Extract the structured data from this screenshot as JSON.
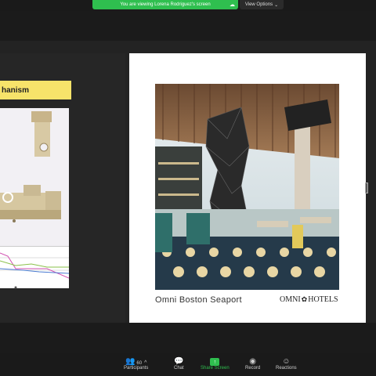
{
  "banner": {
    "text": "You are viewing Lorena Rodriguez's screen",
    "view_options": "View Options"
  },
  "left_slide": {
    "label": "hanism"
  },
  "main_slide": {
    "caption": "Omni Boston Seaport",
    "logo_text_a": "OMNI",
    "logo_text_b": "HOTELS"
  },
  "toolbar": {
    "participants_label": "Participants",
    "participants_count": "60",
    "chat_label": "Chat",
    "share_label": "Share Screen",
    "record_label": "Record",
    "reactions_label": "Reactions"
  },
  "colors": {
    "share_green": "#2fbf4f",
    "label_yellow": "#f7e36a"
  },
  "icons": [
    "cloud-icon",
    "chevron-down-icon",
    "participants-icon",
    "chevron-up-icon",
    "chat-icon",
    "share-screen-icon",
    "record-icon",
    "reactions-icon"
  ]
}
